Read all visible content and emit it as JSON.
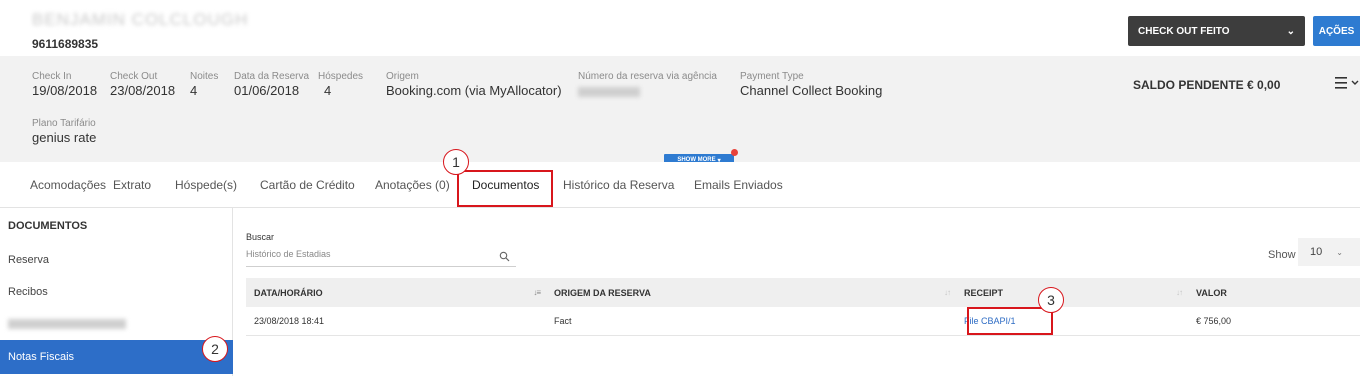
{
  "header": {
    "guest_name": "BENJAMIN COLCLOUGH",
    "phone": "9611689835",
    "checkout_label": "CHECK OUT FEITO",
    "acoes_label": "AÇÕES"
  },
  "info": {
    "check_in_label": "Check In",
    "check_in": "19/08/2018",
    "check_out_label": "Check Out",
    "check_out": "23/08/2018",
    "noites_label": "Noites",
    "noites": "4",
    "data_reserva_label": "Data da Reserva",
    "data_reserva": "01/06/2018",
    "hospedes_label": "Hóspedes",
    "hospedes": "4",
    "origem_label": "Origem",
    "origem": "Booking.com (via MyAllocator)",
    "numero_agencia_label": "Número da reserva via agência",
    "payment_type_label": "Payment Type",
    "payment_type": "Channel Collect Booking",
    "plano_label": "Plano Tarifário",
    "plano": "genius rate",
    "saldo": "SALDO PENDENTE € 0,00",
    "show_more": "SHOW MORE"
  },
  "tabs": [
    "Acomodações",
    "Extrato",
    "Hóspede(s)",
    "Cartão de Crédito",
    "Anotações (0)",
    "Documentos",
    "Histórico da Reserva",
    "Emails Enviados"
  ],
  "callouts": [
    "1",
    "2",
    "3"
  ],
  "sidebar": {
    "title": "DOCUMENTOS",
    "items": [
      "Reserva",
      "Recibos",
      "Notas Fiscais"
    ]
  },
  "search": {
    "label": "Buscar",
    "placeholder": "Histórico de Estadias"
  },
  "show": {
    "label": "Show",
    "value": "10"
  },
  "table": {
    "columns": [
      "DATA/HORÁRIO",
      "ORIGEM DA RESERVA",
      "RECEIPT",
      "VALOR"
    ],
    "rows": [
      {
        "datetime": "23/08/2018 18:41",
        "origem": "Fact",
        "receipt": "File CBAPI/1",
        "valor": "€ 756,00"
      }
    ]
  },
  "colors": {
    "primary_blue": "#2e7bd1",
    "sidebar_active": "#2d6ec8",
    "dark_button": "#3d3d3d",
    "callout_red": "#d8161c"
  }
}
